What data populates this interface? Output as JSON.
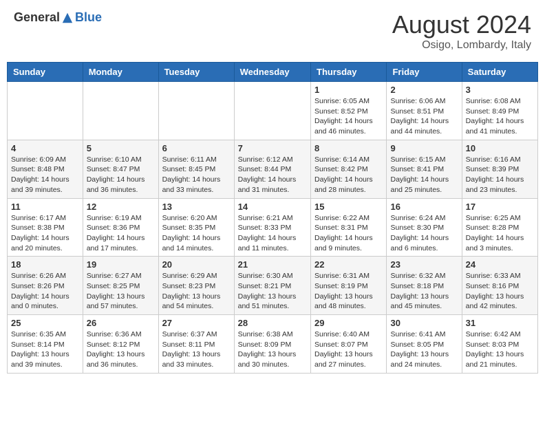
{
  "header": {
    "logo_general": "General",
    "logo_blue": "Blue",
    "month_title": "August 2024",
    "location": "Osigo, Lombardy, Italy"
  },
  "days_of_week": [
    "Sunday",
    "Monday",
    "Tuesday",
    "Wednesday",
    "Thursday",
    "Friday",
    "Saturday"
  ],
  "weeks": [
    [
      {
        "day": "",
        "info": ""
      },
      {
        "day": "",
        "info": ""
      },
      {
        "day": "",
        "info": ""
      },
      {
        "day": "",
        "info": ""
      },
      {
        "day": "1",
        "info": "Sunrise: 6:05 AM\nSunset: 8:52 PM\nDaylight: 14 hours and 46 minutes."
      },
      {
        "day": "2",
        "info": "Sunrise: 6:06 AM\nSunset: 8:51 PM\nDaylight: 14 hours and 44 minutes."
      },
      {
        "day": "3",
        "info": "Sunrise: 6:08 AM\nSunset: 8:49 PM\nDaylight: 14 hours and 41 minutes."
      }
    ],
    [
      {
        "day": "4",
        "info": "Sunrise: 6:09 AM\nSunset: 8:48 PM\nDaylight: 14 hours and 39 minutes."
      },
      {
        "day": "5",
        "info": "Sunrise: 6:10 AM\nSunset: 8:47 PM\nDaylight: 14 hours and 36 minutes."
      },
      {
        "day": "6",
        "info": "Sunrise: 6:11 AM\nSunset: 8:45 PM\nDaylight: 14 hours and 33 minutes."
      },
      {
        "day": "7",
        "info": "Sunrise: 6:12 AM\nSunset: 8:44 PM\nDaylight: 14 hours and 31 minutes."
      },
      {
        "day": "8",
        "info": "Sunrise: 6:14 AM\nSunset: 8:42 PM\nDaylight: 14 hours and 28 minutes."
      },
      {
        "day": "9",
        "info": "Sunrise: 6:15 AM\nSunset: 8:41 PM\nDaylight: 14 hours and 25 minutes."
      },
      {
        "day": "10",
        "info": "Sunrise: 6:16 AM\nSunset: 8:39 PM\nDaylight: 14 hours and 23 minutes."
      }
    ],
    [
      {
        "day": "11",
        "info": "Sunrise: 6:17 AM\nSunset: 8:38 PM\nDaylight: 14 hours and 20 minutes."
      },
      {
        "day": "12",
        "info": "Sunrise: 6:19 AM\nSunset: 8:36 PM\nDaylight: 14 hours and 17 minutes."
      },
      {
        "day": "13",
        "info": "Sunrise: 6:20 AM\nSunset: 8:35 PM\nDaylight: 14 hours and 14 minutes."
      },
      {
        "day": "14",
        "info": "Sunrise: 6:21 AM\nSunset: 8:33 PM\nDaylight: 14 hours and 11 minutes."
      },
      {
        "day": "15",
        "info": "Sunrise: 6:22 AM\nSunset: 8:31 PM\nDaylight: 14 hours and 9 minutes."
      },
      {
        "day": "16",
        "info": "Sunrise: 6:24 AM\nSunset: 8:30 PM\nDaylight: 14 hours and 6 minutes."
      },
      {
        "day": "17",
        "info": "Sunrise: 6:25 AM\nSunset: 8:28 PM\nDaylight: 14 hours and 3 minutes."
      }
    ],
    [
      {
        "day": "18",
        "info": "Sunrise: 6:26 AM\nSunset: 8:26 PM\nDaylight: 14 hours and 0 minutes."
      },
      {
        "day": "19",
        "info": "Sunrise: 6:27 AM\nSunset: 8:25 PM\nDaylight: 13 hours and 57 minutes."
      },
      {
        "day": "20",
        "info": "Sunrise: 6:29 AM\nSunset: 8:23 PM\nDaylight: 13 hours and 54 minutes."
      },
      {
        "day": "21",
        "info": "Sunrise: 6:30 AM\nSunset: 8:21 PM\nDaylight: 13 hours and 51 minutes."
      },
      {
        "day": "22",
        "info": "Sunrise: 6:31 AM\nSunset: 8:19 PM\nDaylight: 13 hours and 48 minutes."
      },
      {
        "day": "23",
        "info": "Sunrise: 6:32 AM\nSunset: 8:18 PM\nDaylight: 13 hours and 45 minutes."
      },
      {
        "day": "24",
        "info": "Sunrise: 6:33 AM\nSunset: 8:16 PM\nDaylight: 13 hours and 42 minutes."
      }
    ],
    [
      {
        "day": "25",
        "info": "Sunrise: 6:35 AM\nSunset: 8:14 PM\nDaylight: 13 hours and 39 minutes."
      },
      {
        "day": "26",
        "info": "Sunrise: 6:36 AM\nSunset: 8:12 PM\nDaylight: 13 hours and 36 minutes."
      },
      {
        "day": "27",
        "info": "Sunrise: 6:37 AM\nSunset: 8:11 PM\nDaylight: 13 hours and 33 minutes."
      },
      {
        "day": "28",
        "info": "Sunrise: 6:38 AM\nSunset: 8:09 PM\nDaylight: 13 hours and 30 minutes."
      },
      {
        "day": "29",
        "info": "Sunrise: 6:40 AM\nSunset: 8:07 PM\nDaylight: 13 hours and 27 minutes."
      },
      {
        "day": "30",
        "info": "Sunrise: 6:41 AM\nSunset: 8:05 PM\nDaylight: 13 hours and 24 minutes."
      },
      {
        "day": "31",
        "info": "Sunrise: 6:42 AM\nSunset: 8:03 PM\nDaylight: 13 hours and 21 minutes."
      }
    ]
  ]
}
